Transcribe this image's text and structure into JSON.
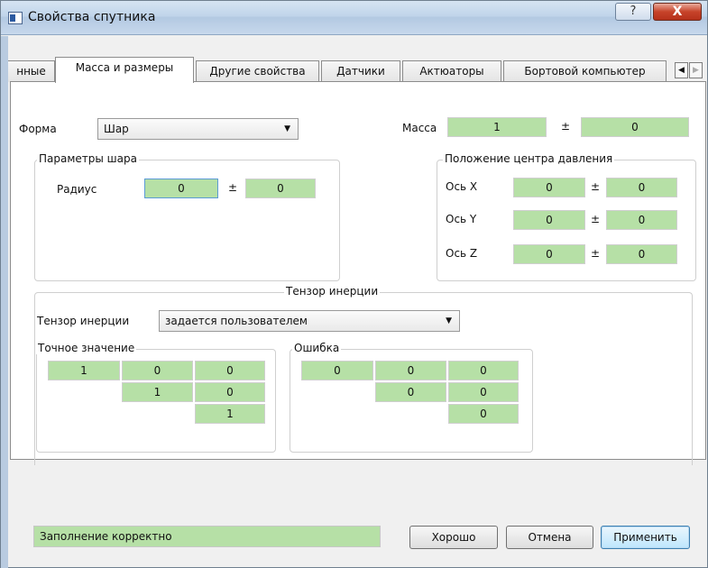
{
  "window": {
    "title": "Свойства спутника",
    "help_symbol": "?",
    "close_symbol": "X"
  },
  "tabs": [
    {
      "label": "нные",
      "active": false
    },
    {
      "label": "Масса и размеры",
      "active": true
    },
    {
      "label": "Другие свойства",
      "active": false
    },
    {
      "label": "Датчики",
      "active": false
    },
    {
      "label": "Актюаторы",
      "active": false
    },
    {
      "label": "Бортовой компьютер",
      "active": false
    }
  ],
  "tab_scroll": {
    "left": "◀",
    "right": "▶"
  },
  "shape": {
    "label": "Форма",
    "value": "Шар"
  },
  "mass": {
    "label": "Масса",
    "value": "1",
    "pm": "±",
    "error": "0"
  },
  "sphere_params": {
    "title": "Параметры шара",
    "radius_label": "Радиус",
    "radius_value": "0",
    "pm": "±",
    "radius_error": "0"
  },
  "pressure_center": {
    "title": "Положение центра давления",
    "rows": [
      {
        "label": "Ось X",
        "value": "0",
        "pm": "±",
        "error": "0"
      },
      {
        "label": "Ось Y",
        "value": "0",
        "pm": "±",
        "error": "0"
      },
      {
        "label": "Ось Z",
        "value": "0",
        "pm": "±",
        "error": "0"
      }
    ]
  },
  "inertia": {
    "title": "Тензор инерции",
    "combo_label": "Тензор инерции",
    "combo_value": "задается пользователем",
    "exact": {
      "title": "Точное значение",
      "cells": [
        "1",
        "0",
        "0",
        "1",
        "0",
        "1"
      ]
    },
    "error": {
      "title": "Ошибка",
      "cells": [
        "0",
        "0",
        "0",
        "0",
        "0",
        "0"
      ]
    }
  },
  "status_text": "Заполнение корректно",
  "buttons": {
    "ok": "Хорошо",
    "cancel": "Отмена",
    "apply": "Применить"
  },
  "colors": {
    "field_green": "#b6e0a6",
    "field_border": "#cfcfcf"
  }
}
